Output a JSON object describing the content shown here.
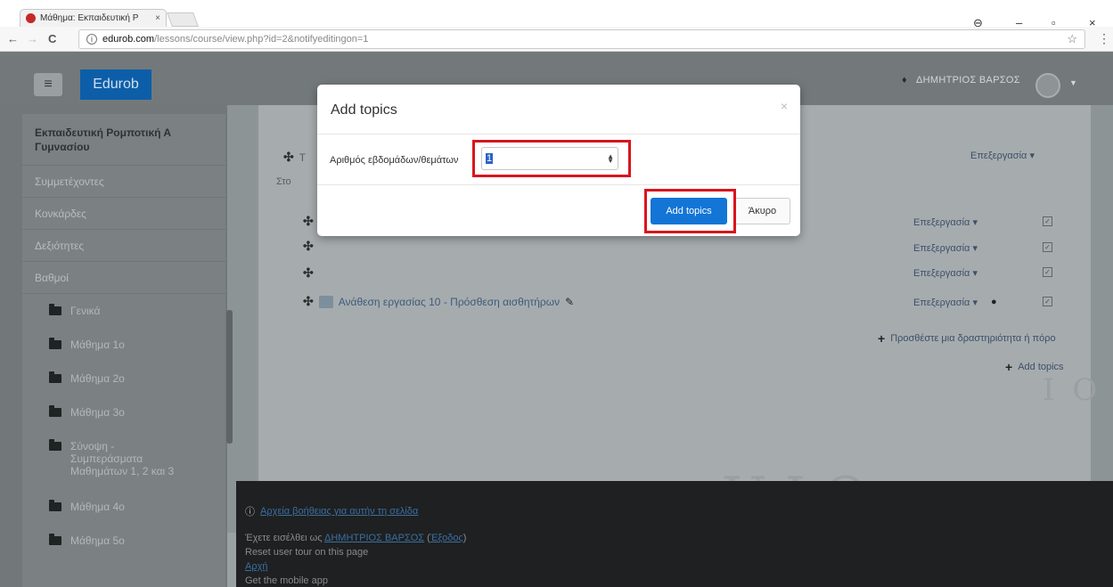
{
  "browser": {
    "tab_title": "Μάθημα: Εκπαιδευτική Ρ",
    "tab_close": "×",
    "url_host": "edurob.com",
    "url_path": "/lessons/course/view.php?id=2&notifyeditingon=1",
    "back": "←",
    "forward": "→",
    "reload": "C",
    "info": "i",
    "star": "☆",
    "menu": "⋮",
    "account": "⊖",
    "minimize": "–",
    "restore": "▫",
    "close": "×"
  },
  "navbar": {
    "menu_icon": "≡",
    "brand": "Edurob",
    "user_name": "ΔΗΜΗΤΡΙΟΣ ΒΑΡΣΟΣ",
    "bell_icon": "bell-icon"
  },
  "drawer": {
    "course": "Εκπαιδευτική Ρομποτική Α Γυμνασίου",
    "items": [
      "Συμμετέχοντες",
      "Κονκάρδες",
      "Δεξιότητες",
      "Βαθμοί"
    ],
    "folders": [
      "Γενικά",
      "Μάθημα 1ο",
      "Μάθημα 2ο",
      "Μάθημα 3ο",
      "Σύνοψη - Συμπεράσματα Μαθημάτων 1, 2 και 3",
      "Μάθημα 4ο",
      "Μάθημα 5ο"
    ]
  },
  "main": {
    "top_row_text": "Τ",
    "top_row_sub": "Στο",
    "edit_label": "Επεξεργασία",
    "caret": "▾",
    "activity": "Ανάθεση εργασίας 10 - Πρόσθεση αισθητήρων",
    "pencil": "✎",
    "move_icon": "✣",
    "add_activity": "Προσθέστε μια δραστηριότητα ή πόρο",
    "add_topics": "Add topics",
    "watermark": "UIO"
  },
  "footer": {
    "help_link": "Αρχεία βοήθειας για αυτήν τη σελίδα",
    "logged_in_prefix": "Έχετε εισέλθει ως",
    "logged_in_user": "ΔΗΜΗΤΡΙΟΣ ΒΑΡΣΟΣ",
    "logout": "Έξοδος",
    "reset_tour": "Reset user tour on this page",
    "home": "Αρχή",
    "mobile_app": "Get the mobile app"
  },
  "modal": {
    "title": "Add topics",
    "close": "×",
    "field_label": "Αριθμός εβδομάδων/θεμάτων",
    "field_value": "1",
    "primary_button": "Add topics",
    "cancel_button": "Άκυρο"
  },
  "colors": {
    "highlight": "#d8151c",
    "primary": "#1375d6",
    "brand": "#0d5ea8"
  }
}
